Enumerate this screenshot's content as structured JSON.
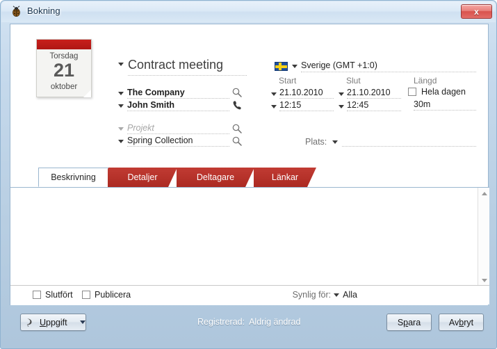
{
  "window": {
    "title": "Bokning",
    "icon": "beetle-icon",
    "close_label": "x",
    "frame_color": "#b9cfe3"
  },
  "calendar": {
    "weekday": "Torsdag",
    "day": "21",
    "month": "oktober",
    "band_color": "#c8201c"
  },
  "form": {
    "subject": "Contract meeting",
    "company": "The Company",
    "contact": "John Smith",
    "project_placeholder": "Projekt",
    "project_value": "Spring Collection",
    "search_icon": "search-icon",
    "phone_icon": "phone-icon"
  },
  "schedule": {
    "timezone": "Sverige (GMT +1:0)",
    "flag": "swedish-flag-icon",
    "headers": {
      "start": "Start",
      "end": "Slut",
      "duration": "Längd"
    },
    "start_date": "21.10.2010",
    "start_time": "12:15",
    "end_date": "21.10.2010",
    "end_time": "12:45",
    "all_day_label": "Hela dagen",
    "all_day_checked": false,
    "duration_value": "30m"
  },
  "location": {
    "label": "Plats:",
    "value": ""
  },
  "tabs": [
    {
      "label": "Beskrivning",
      "active": true
    },
    {
      "label": "Detaljer",
      "active": false
    },
    {
      "label": "Deltagare",
      "active": false
    },
    {
      "label": "Länkar",
      "active": false
    }
  ],
  "description": {
    "text": ""
  },
  "status": {
    "completed_label": "Slutfört",
    "completed_checked": false,
    "published_label": "Publicera",
    "published_checked": false,
    "visible_label": "Synlig för:",
    "visible_value": "Alla"
  },
  "footer": {
    "task_button": "Uppgift",
    "task_accel": "U",
    "registered_label": "Registrerad:",
    "registered_value": "Aldrig ändrad",
    "save_button": "Spara",
    "cancel_button": "Avbryt"
  }
}
